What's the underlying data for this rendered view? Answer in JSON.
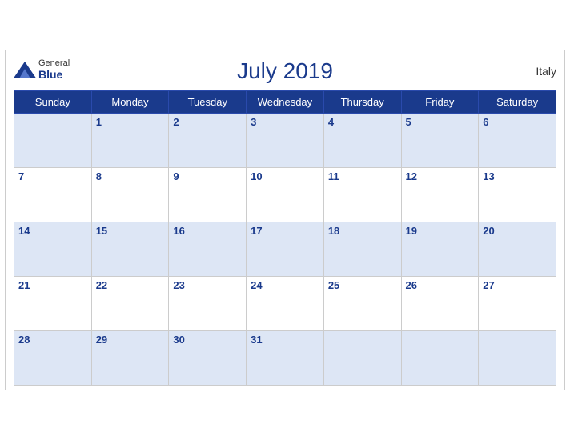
{
  "header": {
    "title": "July 2019",
    "logo_general": "General",
    "logo_blue": "Blue",
    "country": "Italy"
  },
  "weekdays": [
    "Sunday",
    "Monday",
    "Tuesday",
    "Wednesday",
    "Thursday",
    "Friday",
    "Saturday"
  ],
  "weeks": [
    [
      "",
      "1",
      "2",
      "3",
      "4",
      "5",
      "6"
    ],
    [
      "7",
      "8",
      "9",
      "10",
      "11",
      "12",
      "13"
    ],
    [
      "14",
      "15",
      "16",
      "17",
      "18",
      "19",
      "20"
    ],
    [
      "21",
      "22",
      "23",
      "24",
      "25",
      "26",
      "27"
    ],
    [
      "28",
      "29",
      "30",
      "31",
      "",
      "",
      ""
    ]
  ]
}
